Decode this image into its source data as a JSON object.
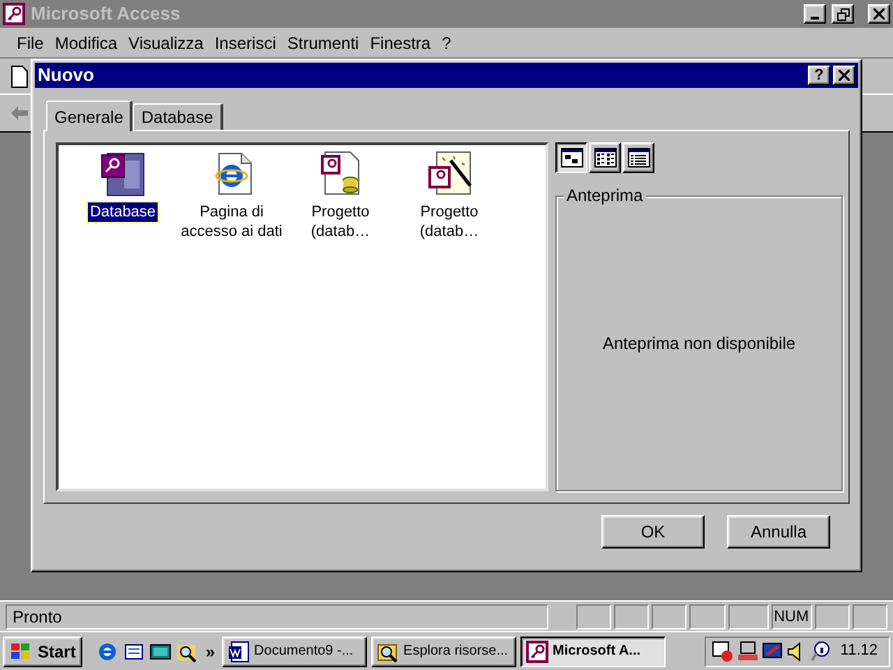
{
  "app": {
    "title": "Microsoft Access",
    "menu": [
      "File",
      "Modifica",
      "Visualizza",
      "Inserisci",
      "Strumenti",
      "Finestra",
      "?"
    ]
  },
  "dialog": {
    "title": "Nuovo",
    "help": "?",
    "tabs": [
      {
        "label": "Generale",
        "selected": true
      },
      {
        "label": "Database",
        "selected": false
      }
    ],
    "items": [
      {
        "label": "Database",
        "kind": "database",
        "selected": true
      },
      {
        "label": "Pagina di accesso ai dati",
        "kind": "page",
        "selected": false
      },
      {
        "label": "Progetto (datab…",
        "kind": "project",
        "selected": false
      },
      {
        "label": "Progetto (datab…",
        "kind": "wizard",
        "selected": false
      }
    ],
    "views": [
      {
        "kind": "large",
        "selected": true
      },
      {
        "kind": "small",
        "selected": false
      },
      {
        "kind": "details",
        "selected": false
      }
    ],
    "preview": {
      "title": "Anteprima",
      "message": "Anteprima non disponibile"
    },
    "buttons": [
      "OK",
      "Annulla"
    ]
  },
  "status_bar": {
    "text": "Pronto",
    "indicators": [
      {
        "label": "NUM",
        "on": true
      }
    ]
  },
  "taskbar": {
    "start": "Start",
    "more": "»",
    "tasks": [
      {
        "label": "Documento9 -...",
        "kind": "word",
        "selected": false
      },
      {
        "label": "Esplora risorse...",
        "kind": "explorer",
        "selected": false
      },
      {
        "label": "Microsoft A...",
        "kind": "access",
        "selected": true
      }
    ],
    "clock": "11.12"
  }
}
